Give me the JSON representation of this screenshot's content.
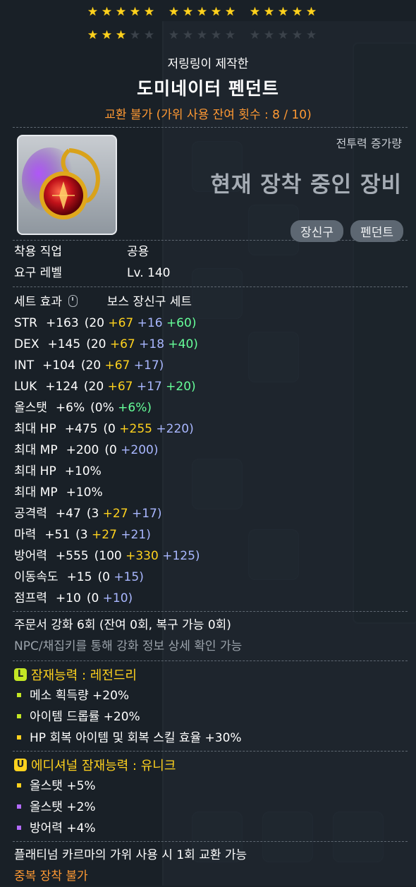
{
  "stars": {
    "row1": [
      5,
      5,
      5
    ],
    "row2_filled": 3,
    "star_char": "★"
  },
  "crafter": "저링링이 제작한",
  "item_name": "도미네이터 펜던트",
  "trade": "교환 불가 (가위 사용 잔여 횟수 : 8 / 10)",
  "combat_power_label": "전투력 증가량",
  "equipped_label": "현재 장착 중인 장비",
  "tags": [
    "장신구",
    "펜던트"
  ],
  "job": {
    "label": "착용 직업",
    "value": "공용"
  },
  "level": {
    "label": "요구 레벨",
    "value": "Lv. 140"
  },
  "set": {
    "label": "세트 효과",
    "value": "보스 장신구 세트"
  },
  "stats": [
    {
      "name": "STR",
      "total": "+163",
      "base": "(20",
      "parts": [
        {
          "t": "+67",
          "c": "y"
        },
        {
          "t": "+16",
          "c": "c"
        },
        {
          "t": "+60)",
          "c": "g"
        }
      ]
    },
    {
      "name": "DEX",
      "total": "+145",
      "base": "(20",
      "parts": [
        {
          "t": "+67",
          "c": "y"
        },
        {
          "t": "+18",
          "c": "c"
        },
        {
          "t": "+40)",
          "c": "g"
        }
      ]
    },
    {
      "name": "INT",
      "total": "+104",
      "base": "(20",
      "parts": [
        {
          "t": "+67",
          "c": "y"
        },
        {
          "t": "+17)",
          "c": "c"
        }
      ]
    },
    {
      "name": "LUK",
      "total": "+124",
      "base": "(20",
      "parts": [
        {
          "t": "+67",
          "c": "y"
        },
        {
          "t": "+17",
          "c": "c"
        },
        {
          "t": "+20)",
          "c": "g"
        }
      ]
    },
    {
      "name": "올스탯",
      "total": "+6%",
      "base": "(0%",
      "parts": [
        {
          "t": "+6%)",
          "c": "g"
        }
      ]
    },
    {
      "name": "최대 HP",
      "total": "+475",
      "base": "(0",
      "parts": [
        {
          "t": "+255",
          "c": "y"
        },
        {
          "t": "+220)",
          "c": "c"
        }
      ]
    },
    {
      "name": "최대 MP",
      "total": "+200",
      "base": "(0",
      "parts": [
        {
          "t": "+200)",
          "c": "c"
        }
      ]
    },
    {
      "name": "최대 HP",
      "total": "+10%",
      "base": "",
      "parts": []
    },
    {
      "name": "최대 MP",
      "total": "+10%",
      "base": "",
      "parts": []
    },
    {
      "name": "공격력",
      "total": "+47",
      "base": "(3",
      "parts": [
        {
          "t": "+27",
          "c": "y"
        },
        {
          "t": "+17)",
          "c": "c"
        }
      ]
    },
    {
      "name": "마력",
      "total": "+51",
      "base": "(3",
      "parts": [
        {
          "t": "+27",
          "c": "y"
        },
        {
          "t": "+21)",
          "c": "c"
        }
      ]
    },
    {
      "name": "방어력",
      "total": "+555",
      "base": "(100",
      "parts": [
        {
          "t": "+330",
          "c": "y"
        },
        {
          "t": "+125)",
          "c": "c"
        }
      ]
    },
    {
      "name": "이동속도",
      "total": "+15",
      "base": "(0",
      "parts": [
        {
          "t": "+15)",
          "c": "c"
        }
      ]
    },
    {
      "name": "점프력",
      "total": "+10",
      "base": "(0",
      "parts": [
        {
          "t": "+10)",
          "c": "c"
        }
      ]
    }
  ],
  "scroll": "주문서 강화 6회 (잔여 0회, 복구 가능 0회)",
  "npc_hint": "NPC/채집키를 통해 강화 정보 상세 확인 가능",
  "potential": {
    "badge": "L",
    "badge_color": "#c3e624",
    "title": "잠재능력 : 레전드리",
    "lines": [
      "메소 획득량 +20%",
      "아이템 드롭률 +20%",
      "HP 회복 아이템 및 회복 스킬 효율 +30%"
    ],
    "bullet_colors": [
      "#c3e624",
      "#c3e624",
      "#ffd21e"
    ]
  },
  "additional": {
    "badge": "U",
    "badge_color": "#ffd21e",
    "title": "에디셔널 잠재능력 : 유니크",
    "lines": [
      "올스탯 +5%",
      "올스탯 +2%",
      "방어력 +4%"
    ],
    "bullet_colors": [
      "#ffd21e",
      "#b36bff",
      "#b36bff"
    ]
  },
  "karma": "플래티넘 카르마의 가위 사용 시 1회 교환 가능",
  "no_dup": "중복 장착 불가"
}
